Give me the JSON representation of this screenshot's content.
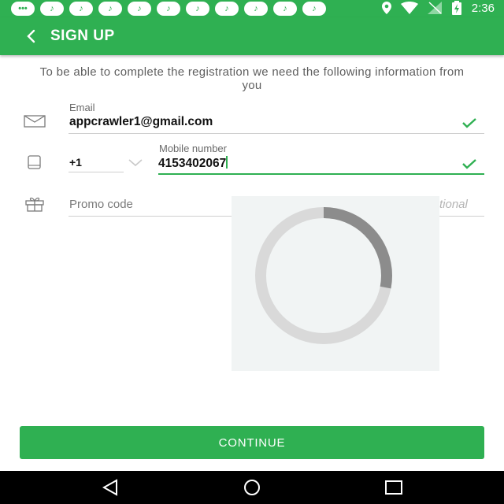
{
  "status_bar": {
    "time": "2:36"
  },
  "app_bar": {
    "title": "SIGN UP"
  },
  "intro": {
    "text": "To be able to complete the registration we need the following information from you"
  },
  "email": {
    "label": "Email",
    "value": "appcrawler1@gmail.com"
  },
  "phone": {
    "country_code": "+1",
    "label": "Mobile number",
    "value": "4153402067"
  },
  "promo": {
    "placeholder": "Promo code",
    "optional_text": "tional"
  },
  "loading": {
    "progress": 0.28
  },
  "continue_button": {
    "label": "CONTINUE"
  },
  "colors": {
    "accent": "#2fb052",
    "spinner_track": "#d9d9d9",
    "spinner_arc": "#8c8c8c"
  }
}
